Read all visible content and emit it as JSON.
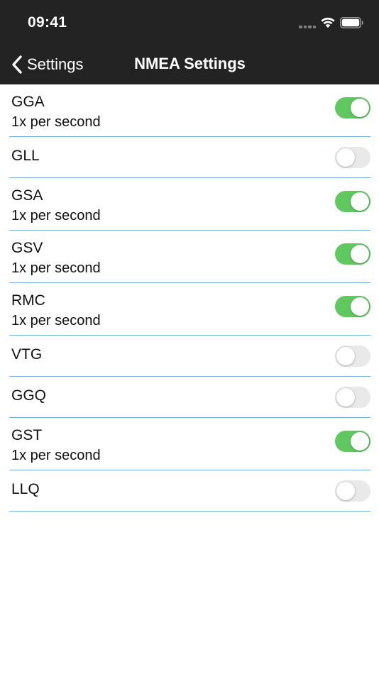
{
  "status_bar": {
    "time": "09:41"
  },
  "nav": {
    "back_label": "Settings",
    "title": "NMEA Settings"
  },
  "colors": {
    "header_bg": "#232323",
    "toggle_on": "#5fc85f",
    "toggle_off": "#e9e9ea",
    "divider": "#6fb3e0"
  },
  "sentences": [
    {
      "name": "GGA",
      "enabled": true,
      "rate": "1x per second"
    },
    {
      "name": "GLL",
      "enabled": false,
      "rate": ""
    },
    {
      "name": "GSA",
      "enabled": true,
      "rate": "1x per second"
    },
    {
      "name": "GSV",
      "enabled": true,
      "rate": "1x per second"
    },
    {
      "name": "RMC",
      "enabled": true,
      "rate": "1x per second"
    },
    {
      "name": "VTG",
      "enabled": false,
      "rate": ""
    },
    {
      "name": "GGQ",
      "enabled": false,
      "rate": ""
    },
    {
      "name": "GST",
      "enabled": true,
      "rate": "1x per second"
    },
    {
      "name": "LLQ",
      "enabled": false,
      "rate": ""
    }
  ]
}
